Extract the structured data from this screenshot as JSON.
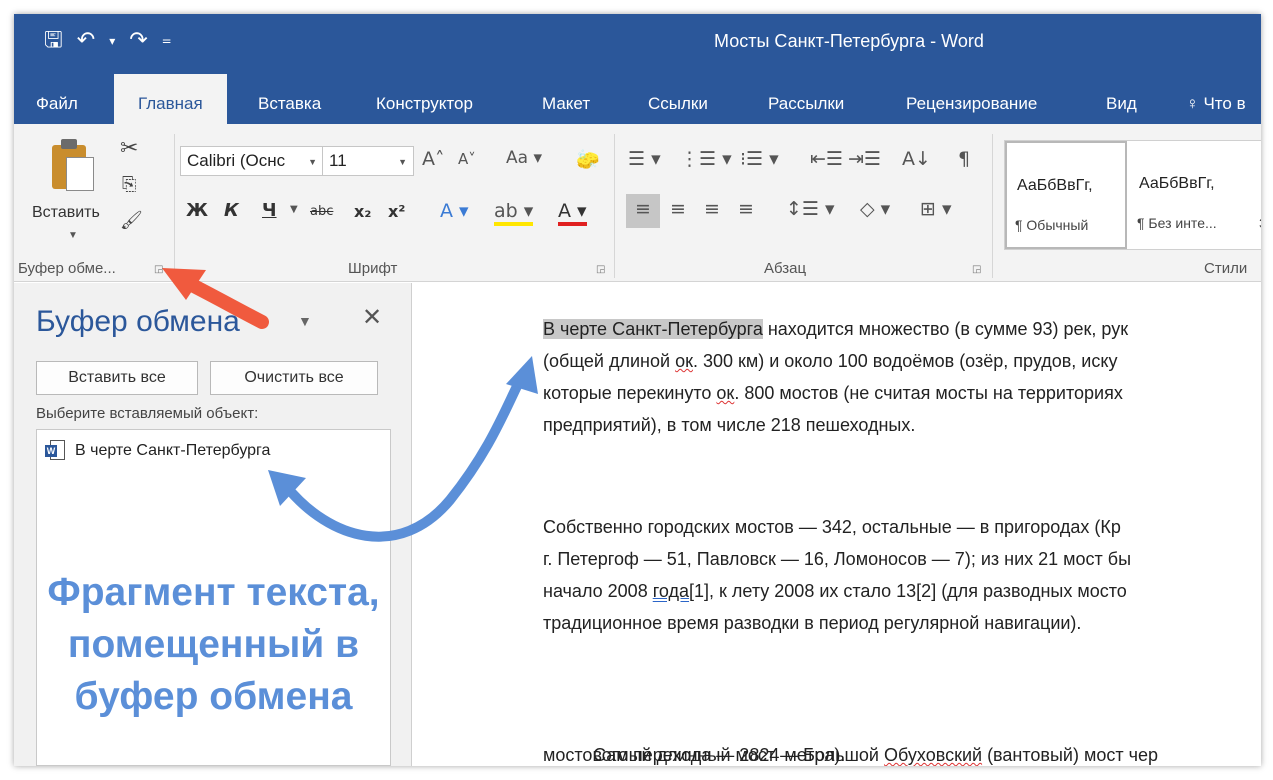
{
  "window": {
    "title": "Мосты Санкт-Петербурга  -  Word",
    "qat": {
      "save": "🖫",
      "undo": "↶",
      "undo_dd": "▾",
      "redo": "↷",
      "customize": "="
    }
  },
  "tabs": [
    "Файл",
    "Главная",
    "Вставка",
    "Конструктор",
    "Макет",
    "Ссылки",
    "Рассылки",
    "Рецензирование",
    "Вид",
    "♀ Что в"
  ],
  "ribbon": {
    "clipboard": {
      "paste_label": "Вставить",
      "group": "Буфер обме...",
      "cut": "✂",
      "copy": "⎘",
      "format_painter": "🖌"
    },
    "font": {
      "name": "Calibri (Оснс",
      "size": "11",
      "grow": "A˄",
      "shrink": "A˅",
      "case": "Aa ▾",
      "clear": "🧽",
      "bold": "Ж",
      "italic": "К",
      "underline": "Ч",
      "strike": "abc",
      "sub": "x₂",
      "sup": "x²",
      "effects": "A ▾",
      "highlight": "ab ▾",
      "color": "A ▾",
      "group": "Шрифт"
    },
    "paragraph": {
      "bullets": "☰ ▾",
      "numbering": "⋮☰ ▾",
      "multilevel": "⁝☰ ▾",
      "outdent": "⇤☰",
      "indent": "⇥☰",
      "sort": "A↓",
      "marks": "¶",
      "align_left": "≡",
      "align_center": "≡",
      "align_right": "≡",
      "justify": "≡",
      "spacing": "↕☰ ▾",
      "shading": "◇ ▾",
      "borders": "⊞ ▾",
      "group": "Абзац"
    },
    "styles": {
      "items": [
        {
          "sample": "АаБбВвГг,",
          "name": "¶ Обычный"
        },
        {
          "sample": "АаБбВвГг,",
          "name": "¶ Без инте..."
        },
        {
          "sample": "А",
          "name": "З"
        }
      ],
      "group": "Стили"
    }
  },
  "pane": {
    "title": "Буфер обмена",
    "menu": "▼",
    "close": "✕",
    "paste_all": "Вставить все",
    "clear_all": "Очистить все",
    "choose_label": "Выберите вставляемый объект:",
    "items": [
      {
        "text": "В черте Санкт-Петербурга"
      }
    ]
  },
  "annotation": {
    "lines": [
      "Фрагмент текста,",
      "помещенный в",
      "буфер обмена"
    ],
    "accent": "#5b8fd8",
    "arrow_red": "#f05a3e"
  },
  "document": {
    "p1": {
      "highlight": "В черте Санкт-Петербурга",
      "rest1": " находится множество (в сумме 93) рек, рук",
      "l2a": "(общей длиной ",
      "l2b": "ок",
      "l2c": ". 300 км) и около 100 водоёмов (озёр, прудов, иску",
      "l3a": "которые перекинуто ",
      "l3b": "ок",
      "l3c": ". 800 мостов (не считая мосты на территориях",
      "l4": "предприятий), в том числе 218 пешеходных."
    },
    "p2": {
      "l1": "Собственно городских мостов — 342, остальные — в пригородах (Кр",
      "l2": "г. Петергоф — 51, Павловск — 16, Ломоносов — 7); из них 21 мост бы",
      "l3a": "начало 2008 ",
      "l3b": "года",
      "l3c": "[1], к лету 2008 их стало 13[2] (для разводных мосто",
      "l4": "традиционное время разводки в период регулярной навигации)."
    },
    "p3": {
      "l1a": "    Самый длинный мост — Большой ",
      "l1b": "Обуховский",
      "l1c": " (вантовый) мост чер",
      "l2": "мостового перехода — 2824 метра)."
    }
  }
}
